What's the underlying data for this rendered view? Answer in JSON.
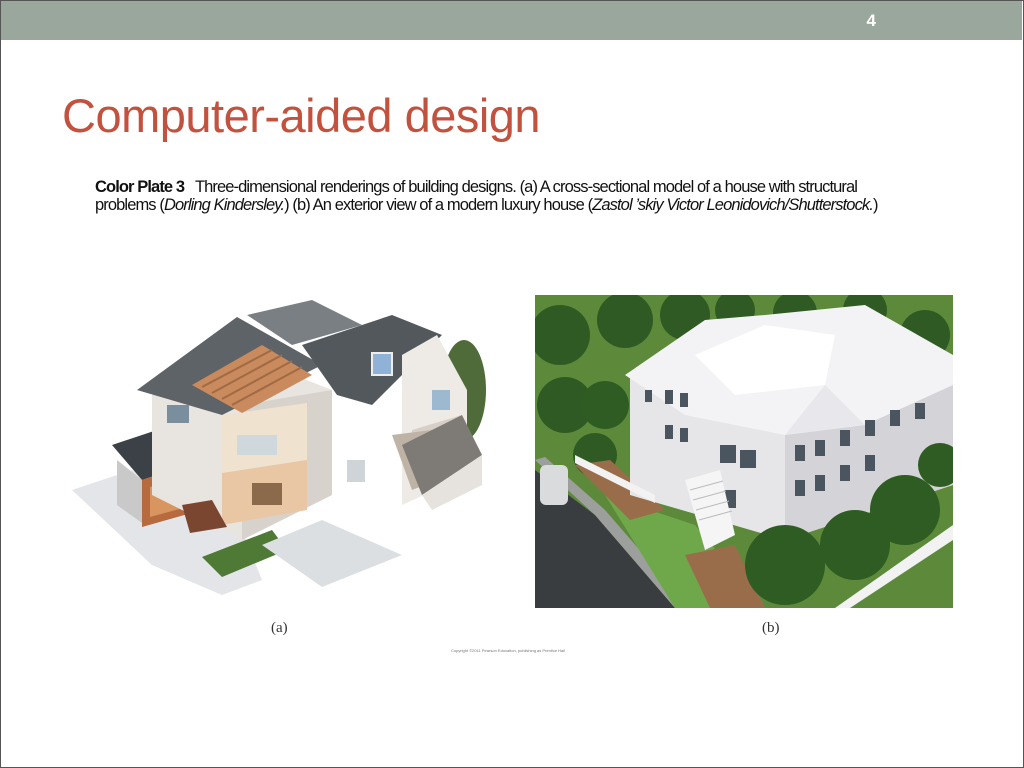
{
  "slide": {
    "number": "4"
  },
  "title": "Computer-aided design",
  "caption": {
    "plate": "Color Plate 3",
    "text1": "Three-dimensional renderings of building designs. (a) A cross-sectional model of a house with structural problems (",
    "credit_a": "Dorling Kindersley.",
    "text2": ") (b) An exterior view of a modern luxury house (",
    "credit_b": "Zastol ’skiy Victor Leonidovich/Shutterstock.",
    "text3": ")"
  },
  "figures": {
    "a_label": "(a)",
    "b_label": "(b)",
    "copyright": "Copyright ©2011 Pearson Education, publishing as Prentice Hall"
  },
  "colors": {
    "bar": "#9aa79c",
    "title": "#c2523d"
  }
}
